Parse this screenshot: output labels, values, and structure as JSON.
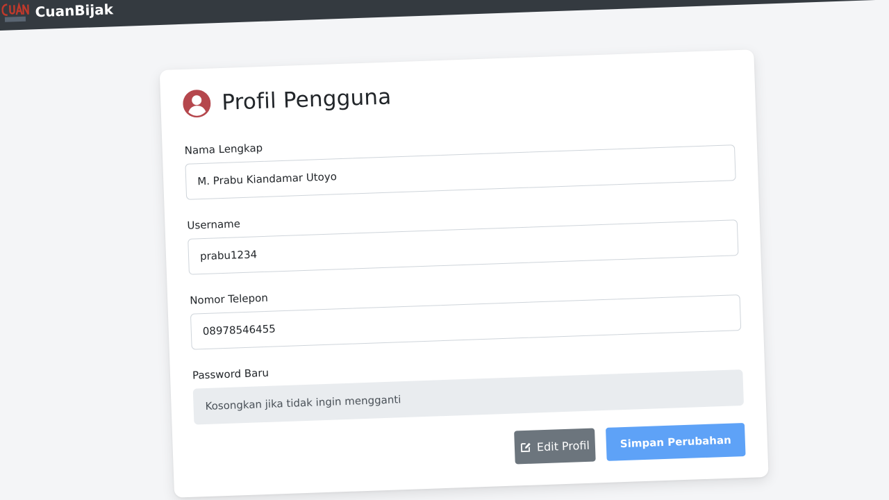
{
  "navbar": {
    "brand_name": "CuanBijak",
    "logo_icon": "cuanbijak-logo-icon"
  },
  "profile": {
    "title": "Profil Pengguna",
    "title_icon": "user-circle-icon",
    "accent_color": "#b5474d",
    "fields": {
      "full_name": {
        "label": "Nama Lengkap",
        "value": "M. Prabu Kiandamar Utoyo"
      },
      "username": {
        "label": "Username",
        "value": "prabu1234"
      },
      "phone": {
        "label": "Nomor Telepon",
        "value": "08978546455"
      },
      "new_password": {
        "label": "Password Baru",
        "value": "",
        "placeholder": "Kosongkan jika tidak ingin mengganti"
      }
    },
    "buttons": {
      "edit_label": "Edit Profil",
      "edit_icon": "edit-icon",
      "save_label": "Simpan Perubahan"
    },
    "colors": {
      "navbar": "#343a40",
      "edit_button": "#6c757d",
      "save_button": "#5ea2f7"
    }
  }
}
